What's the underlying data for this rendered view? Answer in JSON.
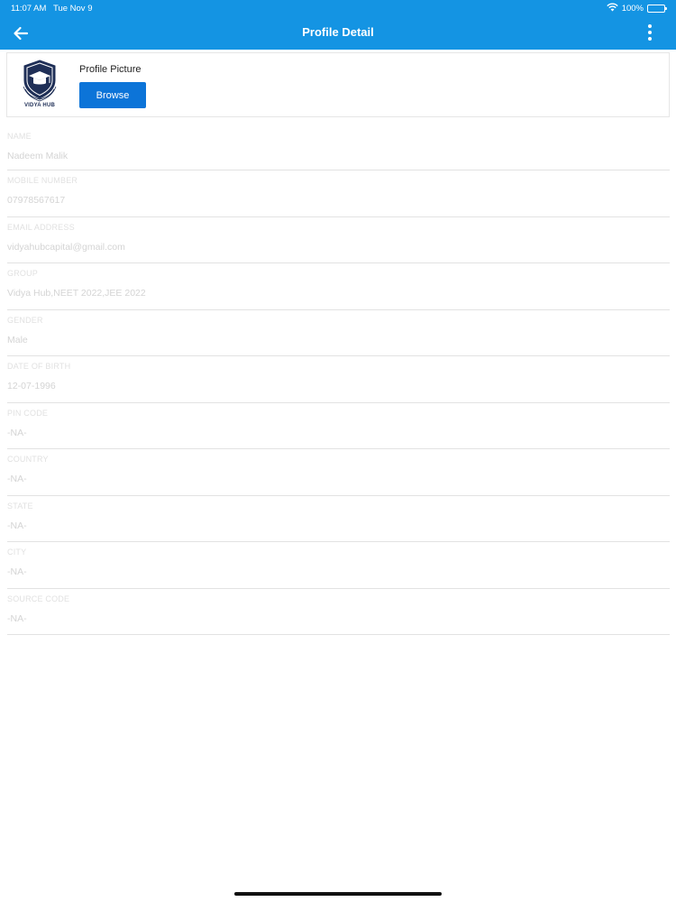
{
  "status_bar": {
    "time": "11:07 AM",
    "date": "Tue Nov 9",
    "battery_text": "100%",
    "icons": [
      "wifi-icon",
      "battery-icon"
    ]
  },
  "nav": {
    "title": "Profile Detail",
    "back_icon": "back-arrow-icon",
    "menu_icon": "more-vertical-icon"
  },
  "profile_picture": {
    "label": "Profile Picture",
    "browse_label": "Browse",
    "logo_text": "VIDYA HUB"
  },
  "fields": [
    {
      "label": "NAME",
      "value": "Nadeem Malik"
    },
    {
      "label": "MOBILE NUMBER",
      "value": "07978567617"
    },
    {
      "label": "EMAIL ADDRESS",
      "value": "vidyahubcapital@gmail.com"
    },
    {
      "label": "GROUP",
      "value": "Vidya Hub,NEET 2022,JEE 2022"
    },
    {
      "label": "GENDER",
      "value": "Male"
    },
    {
      "label": "DATE OF BIRTH",
      "value": "12-07-1996"
    },
    {
      "label": "PIN CODE",
      "value": "-NA-"
    },
    {
      "label": "COUNTRY",
      "value": "-NA-"
    },
    {
      "label": "STATE",
      "value": "-NA-"
    },
    {
      "label": "CITY",
      "value": "-NA-"
    },
    {
      "label": "SOURCE CODE",
      "value": "-NA-"
    }
  ],
  "colors": {
    "header": "#1494e3",
    "button": "#0c74d8",
    "label": "#e1e1e1",
    "value": "#d4d4d4"
  }
}
